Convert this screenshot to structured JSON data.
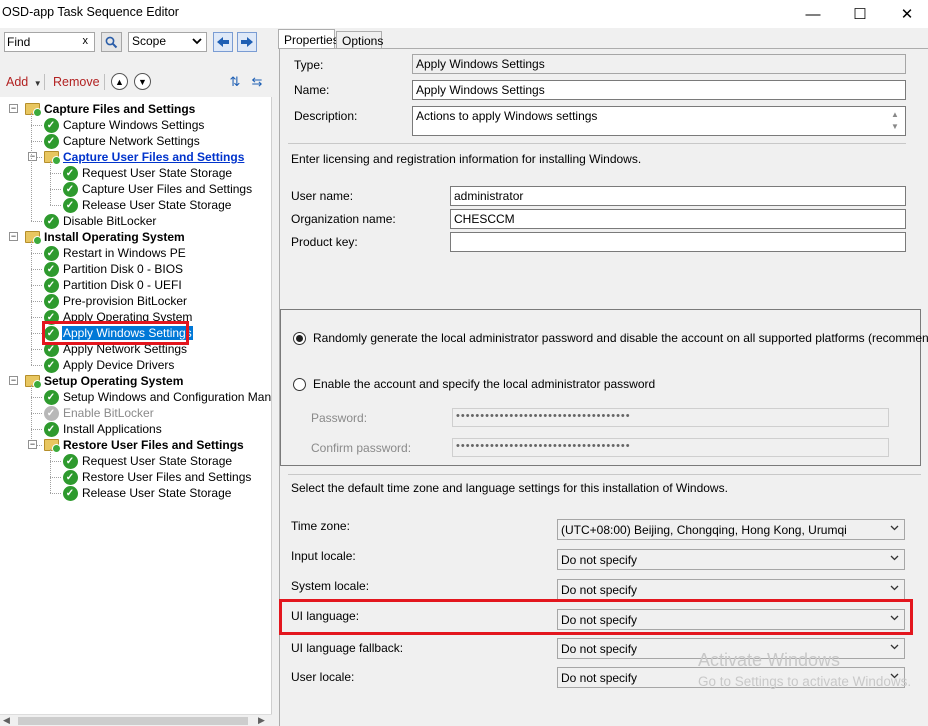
{
  "window": {
    "title": "OSD-app Task Sequence Editor",
    "controls": [
      "—",
      "☐",
      "✕"
    ]
  },
  "toolbar": {
    "find_value": "Find",
    "clear_glyph": "x",
    "scope_value": "Scope",
    "add_label": "Add",
    "remove_label": "Remove"
  },
  "tree": [
    {
      "label": "Capture Files and Settings",
      "level": 0,
      "type": "group",
      "style": "bold"
    },
    {
      "label": "Capture Windows Settings",
      "level": 1,
      "type": "step"
    },
    {
      "label": "Capture Network Settings",
      "level": 1,
      "type": "step"
    },
    {
      "label": "Capture User Files and Settings",
      "level": 1,
      "type": "group",
      "style": "link"
    },
    {
      "label": "Request User State Storage",
      "level": 2,
      "type": "step"
    },
    {
      "label": "Capture User Files and Settings",
      "level": 2,
      "type": "step"
    },
    {
      "label": "Release User State Storage",
      "level": 2,
      "type": "step"
    },
    {
      "label": "Disable BitLocker",
      "level": 1,
      "type": "step"
    },
    {
      "label": "Install Operating System",
      "level": 0,
      "type": "group",
      "style": "bold"
    },
    {
      "label": "Restart in Windows PE",
      "level": 1,
      "type": "step"
    },
    {
      "label": "Partition Disk 0 - BIOS",
      "level": 1,
      "type": "step"
    },
    {
      "label": "Partition Disk 0 - UEFI",
      "level": 1,
      "type": "step"
    },
    {
      "label": "Pre-provision BitLocker",
      "level": 1,
      "type": "step"
    },
    {
      "label": "Apply Operating System",
      "level": 1,
      "type": "step"
    },
    {
      "label": "Apply Windows Settings",
      "level": 1,
      "type": "step",
      "style": "selected"
    },
    {
      "label": "Apply Network Settings",
      "level": 1,
      "type": "step"
    },
    {
      "label": "Apply Device Drivers",
      "level": 1,
      "type": "step"
    },
    {
      "label": "Setup Operating System",
      "level": 0,
      "type": "group",
      "style": "bold"
    },
    {
      "label": "Setup Windows and Configuration Manager",
      "level": 1,
      "type": "step"
    },
    {
      "label": "Enable BitLocker",
      "level": 1,
      "type": "step",
      "style": "disabled"
    },
    {
      "label": "Install Applications",
      "level": 1,
      "type": "step"
    },
    {
      "label": "Restore User Files and Settings",
      "level": 1,
      "type": "group",
      "style": "bold"
    },
    {
      "label": "Request User State Storage",
      "level": 2,
      "type": "step"
    },
    {
      "label": "Restore User Files and Settings",
      "level": 2,
      "type": "step"
    },
    {
      "label": "Release User State Storage",
      "level": 2,
      "type": "step"
    }
  ],
  "tabs": {
    "properties": "Properties",
    "options": "Options"
  },
  "props": {
    "type_label": "Type:",
    "type_value": "Apply Windows Settings",
    "name_label": "Name:",
    "name_value": "Apply Windows Settings",
    "desc_label": "Description:",
    "desc_value": "Actions to apply Windows settings",
    "licensing_text": "Enter licensing and registration information for installing Windows.",
    "username_label": "User name:",
    "username_value": "administrator",
    "org_label": "Organization name:",
    "org_value": "CHESCCM",
    "product_label": "Product key:",
    "product_value": ""
  },
  "password": {
    "radio1": "Randomly generate the local administrator password and disable the account on all supported platforms (recommended)",
    "radio2": "Enable the account and specify the local administrator password",
    "password_label": "Password:",
    "confirm_label": "Confirm password:",
    "password_mask": "••••••••••••••••••••••••••••••••••••",
    "confirm_mask": "••••••••••••••••••••••••••••••••••••"
  },
  "locale": {
    "intro": "Select the default time zone and language settings for this installation of Windows.",
    "timezone_label": "Time zone:",
    "timezone_value": "(UTC+08:00) Beijing, Chongqing, Hong Kong, Urumqi",
    "input_label": "Input locale:",
    "input_value": "Do not specify",
    "system_label": "System locale:",
    "system_value": "Do not specify",
    "ui_label": "UI language:",
    "ui_value": "Do not specify",
    "fallback_label": "UI language fallback:",
    "fallback_value": "Do not specify",
    "user_label": "User locale:",
    "user_value": "Do not specify"
  },
  "watermark": {
    "line1": "Activate Windows",
    "line2": "Go to Settings to activate Windows."
  },
  "colors": {
    "highlight": "#e3161e",
    "selection": "#0078d7",
    "step_ok": "#2e9a2e"
  }
}
